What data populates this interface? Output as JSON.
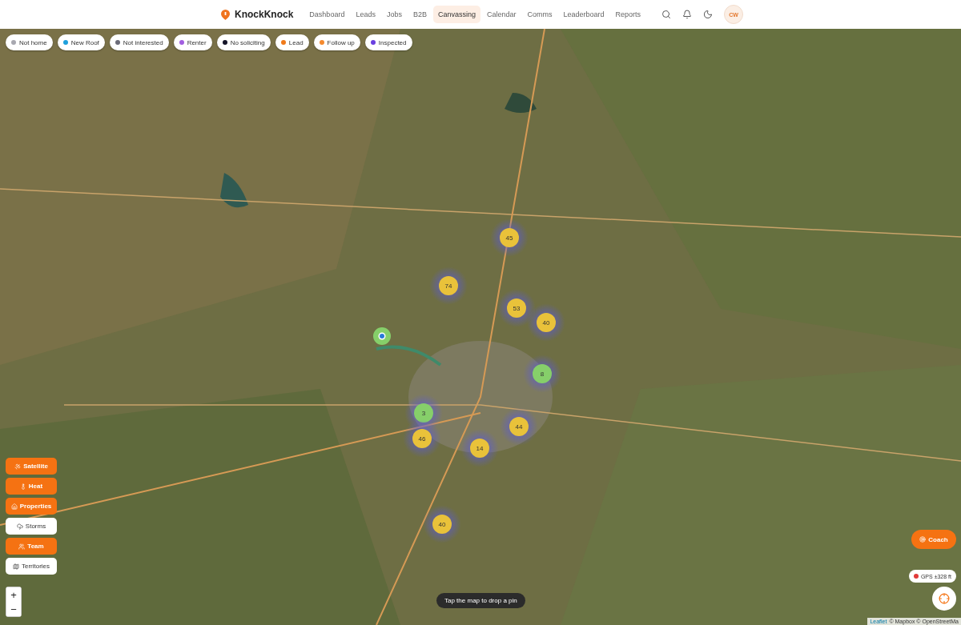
{
  "brand": {
    "name": "KnockKnock"
  },
  "nav": [
    {
      "label": "Dashboard",
      "selected": false
    },
    {
      "label": "Leads",
      "selected": false
    },
    {
      "label": "Jobs",
      "selected": false
    },
    {
      "label": "B2B",
      "selected": false
    },
    {
      "label": "Canvassing",
      "selected": true
    },
    {
      "label": "Calendar",
      "selected": false
    },
    {
      "label": "Comms",
      "selected": false
    },
    {
      "label": "Leaderboard",
      "selected": false
    },
    {
      "label": "Reports",
      "selected": false
    }
  ],
  "user": {
    "initials": "CW"
  },
  "legend": [
    {
      "label": "Not home",
      "color": "#a8a8b0"
    },
    {
      "label": "New Roof",
      "color": "#1ea0dc"
    },
    {
      "label": "Not interested",
      "color": "#6b6b78"
    },
    {
      "label": "Renter",
      "color": "#a25ee0"
    },
    {
      "label": "No soliciting",
      "color": "#141428"
    },
    {
      "label": "Lead",
      "color": "#f07a1a"
    },
    {
      "label": "Follow up",
      "color": "#f58a2e"
    },
    {
      "label": "Inspected",
      "color": "#6a3fe0"
    }
  ],
  "clusters": [
    {
      "count": "45",
      "color": "#e9c23a"
    },
    {
      "count": "74",
      "color": "#e9c23a"
    },
    {
      "count": "53",
      "color": "#e9c23a"
    },
    {
      "count": "40",
      "color": "#e9c23a"
    },
    {
      "count": "8",
      "color": "#86cf6a"
    },
    {
      "count": "3",
      "color": "#86cf6a"
    },
    {
      "count": "46",
      "color": "#e9c23a"
    },
    {
      "count": "44",
      "color": "#e9c23a"
    },
    {
      "count": "14",
      "color": "#e9c23a"
    },
    {
      "count": "40",
      "color": "#e9c23a"
    }
  ],
  "layers": [
    {
      "kind": "satellite",
      "label": "Satellite",
      "on": true
    },
    {
      "kind": "heat",
      "label": "Heat",
      "on": true
    },
    {
      "kind": "properties",
      "label": "Properties",
      "on": true
    },
    {
      "kind": "storms",
      "label": "Storms",
      "on": false
    },
    {
      "kind": "team",
      "label": "Team",
      "on": true
    },
    {
      "kind": "territories",
      "label": "Territories",
      "on": false
    }
  ],
  "zoom": {
    "in": "+",
    "out": "−"
  },
  "hint": "Tap the map to drop a pin",
  "coach": {
    "label": "Coach"
  },
  "gps": {
    "label": "GPS ±328 ft",
    "color": "#e23a3a"
  },
  "attribution": {
    "link": "Leaflet",
    "text": "© Mapbox © OpenStreetMa"
  }
}
